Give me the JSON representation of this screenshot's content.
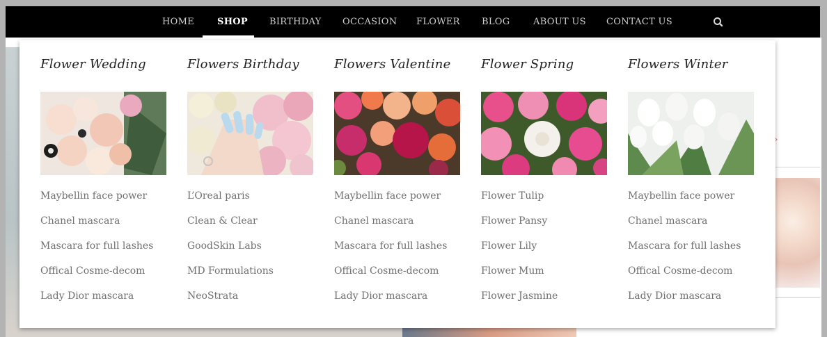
{
  "nav": {
    "items": [
      {
        "label": "HOME",
        "active": false
      },
      {
        "label": "SHOP",
        "active": true
      },
      {
        "label": "BIRTHDAY",
        "active": false
      },
      {
        "label": "OCCASION",
        "active": false
      },
      {
        "label": "FLOWER",
        "active": false
      },
      {
        "label": "BLOG",
        "active": false
      },
      {
        "label": "ABOUT US",
        "active": false
      },
      {
        "label": "CONTACT US",
        "active": false
      }
    ],
    "search_icon": "search-icon"
  },
  "mega_menu": {
    "columns": [
      {
        "title": "Flower Wedding",
        "image": "wedding-bouquet-image",
        "links": [
          "Maybellin face power",
          "Chanel mascara",
          "Mascara for full lashes",
          "Offical Cosme-decom",
          "Lady Dior mascara"
        ]
      },
      {
        "title": "Flowers Birthday",
        "image": "birthday-hand-flowers-image",
        "links": [
          "L’Oreal paris",
          "Clean & Clear",
          "GoodSkin Labs",
          "MD Formulations",
          "NeoStrata"
        ]
      },
      {
        "title": "Flowers Valentine",
        "image": "valentine-bouquet-image",
        "links": [
          "Maybellin face power",
          "Chanel mascara",
          "Mascara for full lashes",
          "Offical Cosme-decom",
          "Lady Dior mascara"
        ]
      },
      {
        "title": "Flower Spring",
        "image": "spring-peonies-image",
        "links": [
          "Flower Tulip",
          "Flower Pansy",
          "Flower Lily",
          "Flower Mum",
          "Flower Jasmine"
        ]
      },
      {
        "title": "Flowers Winter",
        "image": "winter-tulips-image",
        "links": [
          "Maybellin face power",
          "Chanel mascara",
          "Mascara for full lashes",
          "Offical Cosme-decom",
          "Lady Dior mascara"
        ]
      }
    ]
  },
  "colors": {
    "nav_bg": "#000000",
    "nav_text": "#cfcfcf",
    "nav_active": "#ffffff",
    "link_text": "#6f6f6f",
    "title_text": "#222222"
  }
}
